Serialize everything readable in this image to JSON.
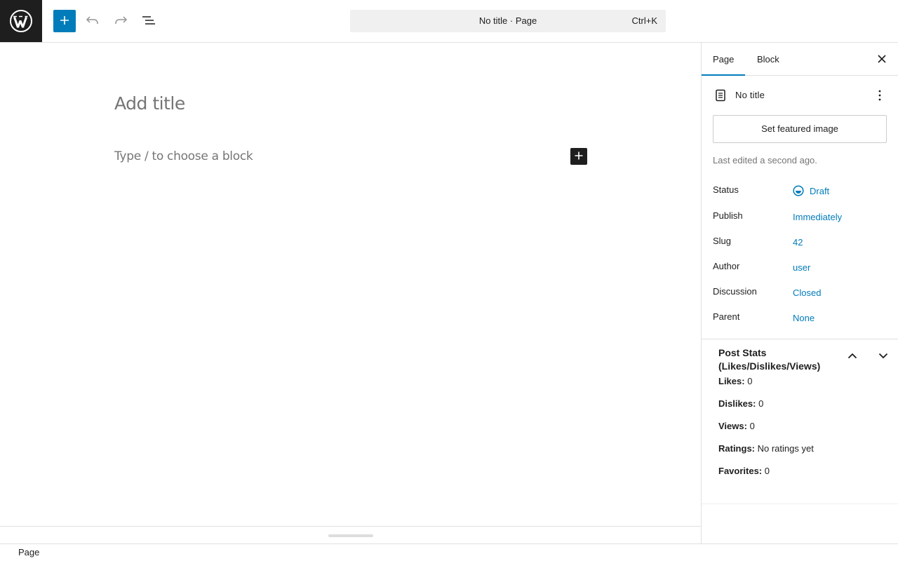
{
  "toolbar": {
    "logo_icon": "wordpress-logo-icon",
    "inserter_icon": "plus-icon",
    "undo_icon": "undo-icon",
    "redo_icon": "redo-icon",
    "document_overview_icon": "list-view-icon",
    "command_bar": {
      "title": "No title · Page",
      "shortcut": "Ctrl+K"
    }
  },
  "editor": {
    "title_placeholder": "Add title",
    "block_placeholder": "Type / to choose a block",
    "block_add_icon": "plus-icon"
  },
  "footer": {
    "breadcrumb": "Page"
  },
  "sidebar": {
    "tabs": [
      {
        "label": "Page",
        "active": true
      },
      {
        "label": "Block",
        "active": false
      }
    ],
    "close_icon": "close-icon",
    "document": {
      "icon": "page-icon",
      "title": "No title",
      "more_icon": "more-vertical-icon"
    },
    "featured_image_label": "Set featured image",
    "last_edited": "Last edited a second ago.",
    "meta": [
      {
        "label": "Status",
        "value": "Draft",
        "icon": "draft-status-icon"
      },
      {
        "label": "Publish",
        "value": "Immediately"
      },
      {
        "label": "Slug",
        "value": "42"
      },
      {
        "label": "Author",
        "value": "user"
      },
      {
        "label": "Discussion",
        "value": "Closed"
      },
      {
        "label": "Parent",
        "value": "None"
      }
    ],
    "stats": {
      "title": "Post Stats (Likes/Dislikes/Views)",
      "up_icon": "chevron-up-icon",
      "down_icon": "chevron-down-icon",
      "items": [
        {
          "label": "Likes:",
          "value": "0"
        },
        {
          "label": "Dislikes:",
          "value": "0"
        },
        {
          "label": "Views:",
          "value": "0"
        },
        {
          "label": "Ratings:",
          "value": "No ratings yet"
        },
        {
          "label": "Favorites:",
          "value": "0"
        }
      ]
    }
  },
  "colors": {
    "accent": "#007cba",
    "dark": "#1e1e1e",
    "muted": "#757575",
    "border": "#e0e0e0"
  }
}
